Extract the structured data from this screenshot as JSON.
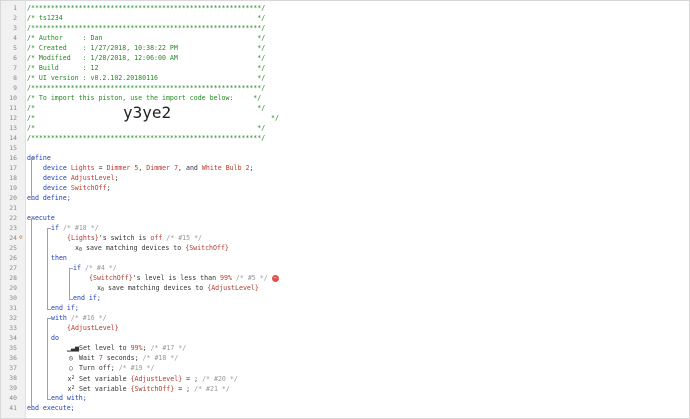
{
  "line_numbers": [
    "1",
    "2",
    "3",
    "4",
    "5",
    "6",
    "7",
    "8",
    "9",
    "10",
    "11",
    "12",
    "13",
    "14",
    "15",
    "16",
    "17",
    "18",
    "19",
    "20",
    "21",
    "22",
    "23",
    "24",
    "25",
    "26",
    "27",
    "28",
    "29",
    "30",
    "31",
    "32",
    "33",
    "34",
    "35",
    "36",
    "37",
    "38",
    "39",
    "40",
    "41"
  ],
  "header": {
    "l1": "/**********************************************************/",
    "l2": "/* ts1234                                                 */",
    "l3": "/**********************************************************/",
    "l4": "/* Author     : Dan                                       */",
    "l5": "/* Created    : 1/27/2018, 10:38:22 PM                    */",
    "l6": "/* Modified   : 1/28/2018, 12:06:00 AM                    */",
    "l7": "/* Build      : 12                                        */",
    "l8": "/* UI version : v0.2.102.20180116                         */",
    "l9": "/**********************************************************/",
    "l10": "/* To import this piston, use the import code below:     */",
    "l11": "/*                                                        */",
    "l12_open": "/*",
    "l12_close": "*/",
    "import_code": "y3ye2",
    "l13": "/*                                                        */",
    "l14": "/**********************************************************/"
  },
  "define": {
    "kw_define": "define",
    "kw_device": "device",
    "lights_name": "Lights",
    "eq": " = ",
    "dimmer5": "Dimmer 5",
    "comma1": ", ",
    "dimmer7": "Dimmer 7",
    "comma_and": ", and ",
    "whitebulb": "White Bulb 2",
    "semicolon": ";",
    "adjust_level": "AdjustLevel",
    "switch_off": "SwitchOff",
    "end_define": "end define;"
  },
  "execute": {
    "kw_execute": "execute",
    "kw_if": "if",
    "c18": "/* #18 */",
    "cond1_pre": "{Lights}",
    "cond1_mid": "'s switch is ",
    "cond1_val": "off",
    "c15": "/* #15 */",
    "save1_pre": " save matching devices to ",
    "save1_var": "{SwitchOff}",
    "kw_then": "then",
    "c4": "/* #4 */",
    "cond2_pre": "{SwitchOff}",
    "cond2_mid": "'s level is less than ",
    "cond2_val": "99%",
    "c5": "/* #5 */",
    "remove_icon": "remove-icon",
    "save2_var": "{AdjustLevel}",
    "end_if_inner": "end if;",
    "end_if_outer": "end if;",
    "kw_with": "with",
    "c16": "/* #16 */",
    "with_target": "{AdjustLevel}",
    "kw_do": "do",
    "set_level_pre": " Set level to ",
    "set_level_val": "99%",
    "set_level_post": ";",
    "c17": "/* #17 */",
    "wait_pre": " Wait ",
    "wait_val": "7",
    "wait_post": " seconds;",
    "c18b": "/* #18 */",
    "turn_off": " Turn off;",
    "c19": "/* #19 */",
    "setvar1_pre": " Set variable ",
    "setvar1_var": "{AdjustLevel}",
    "setvar_eq": " = ;",
    "c20": "/* #20 */",
    "setvar2_var": "{SwitchOff}",
    "c21": "/* #21 */",
    "end_with": "end with;",
    "end_execute": "end execute;"
  },
  "gutter_marks": {
    "line24": "⊘"
  },
  "icons": {
    "level": "level-bars-icon",
    "wait": "clock-icon",
    "off": "power-circle-icon",
    "var": "variable-x-icon",
    "subscript_x": "x-sub-icon"
  },
  "colors": {
    "comment": "#228b22",
    "keyword": "#1a3fb5",
    "device": "#c0392b",
    "remove": "#d9534f"
  }
}
